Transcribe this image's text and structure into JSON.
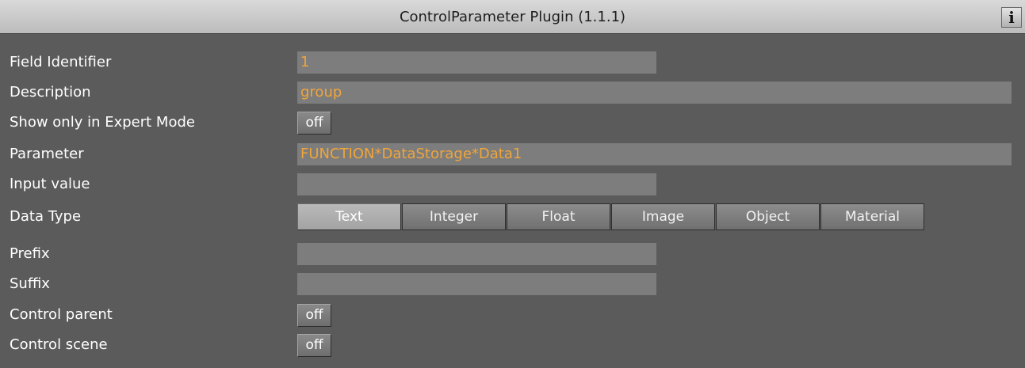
{
  "window": {
    "title": "ControlParameter Plugin (1.1.1)",
    "info_label": "i"
  },
  "fields": {
    "field_identifier": {
      "label": "Field Identifier",
      "value": "1"
    },
    "description": {
      "label": "Description",
      "value": "group"
    },
    "show_expert": {
      "label": "Show only in Expert Mode",
      "value": "off"
    },
    "parameter": {
      "label": "Parameter",
      "value": "FUNCTION*DataStorage*Data1"
    },
    "input_value": {
      "label": "Input value",
      "value": ""
    },
    "data_type": {
      "label": "Data Type",
      "options": [
        "Text",
        "Integer",
        "Float",
        "Image",
        "Object",
        "Material"
      ],
      "selected": "Text"
    },
    "prefix": {
      "label": "Prefix",
      "value": ""
    },
    "suffix": {
      "label": "Suffix",
      "value": ""
    },
    "control_parent": {
      "label": "Control parent",
      "value": "off"
    },
    "control_scene": {
      "label": "Control scene",
      "value": "off"
    }
  },
  "colors": {
    "panel_background": "#5b5b5b",
    "field_background": "#7d7d7d",
    "value_text": "#f0a53a",
    "label_text": "#ffffff"
  }
}
